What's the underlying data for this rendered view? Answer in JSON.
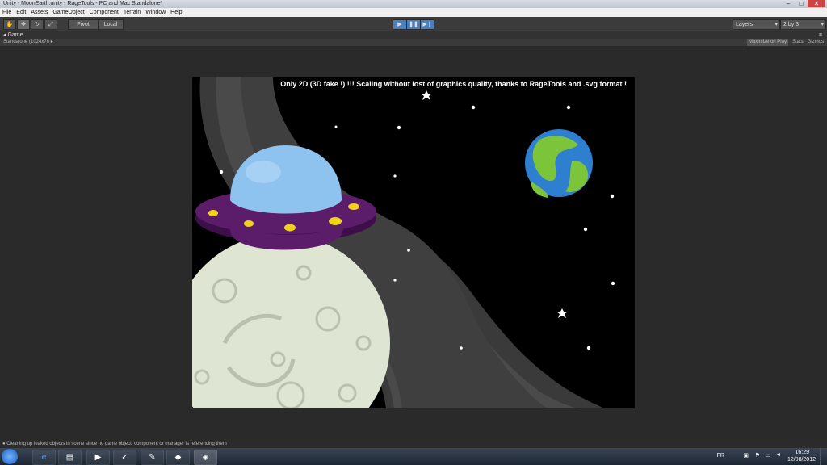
{
  "window": {
    "title": "Unity - MoonEarth.unity - RageTools - PC and Mac Standalone*"
  },
  "menu": [
    "File",
    "Edit",
    "Assets",
    "GameObject",
    "Component",
    "Terrain",
    "Window",
    "Help"
  ],
  "toolbar": {
    "pivot_label": "Pivot",
    "local_label": "Local",
    "layers_label": "Layers",
    "layout_label": "2 by 3"
  },
  "game_tab": {
    "label": "Game"
  },
  "game_bar": {
    "resolution": "Standalone (1024x76",
    "maximize_label": "Maximize on Play",
    "stats_label": "Stats",
    "gizmos_label": "Gizmos"
  },
  "scene": {
    "caption": "Only 2D (3D fake !) !!! Scaling without lost of graphics quality, thanks to RageTools and .svg format !"
  },
  "status": {
    "message": "Cleaning up leaked objects in scene since no game object, component or manager is referencing them"
  },
  "taskbar": {
    "language": "FR",
    "time": "16:29",
    "date": "12/08/2012"
  },
  "colors": {
    "accent": "#4a7fbf",
    "ufo_body": "#5b1d6a",
    "ufo_dome": "#8fc3ef",
    "moon": "#dfe5d3"
  }
}
